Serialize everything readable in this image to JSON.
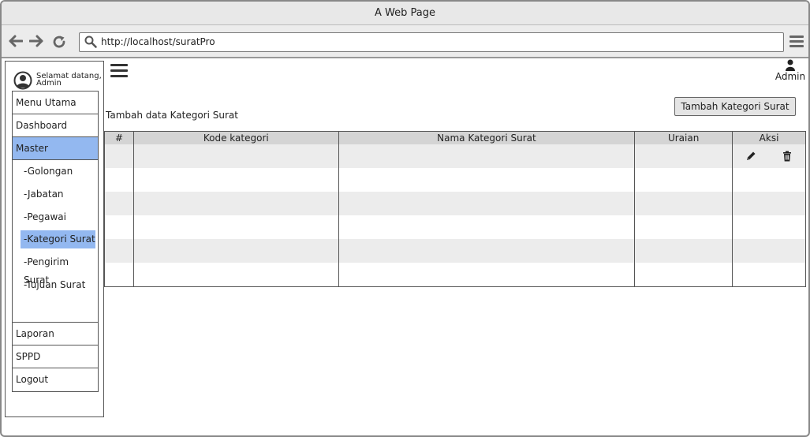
{
  "window": {
    "title": "A Web Page"
  },
  "browser": {
    "url": "http://localhost/suratPro",
    "icons": [
      "back-arrow-icon",
      "forward-arrow-icon",
      "reload-icon",
      "search-icon",
      "menu-icon"
    ]
  },
  "sidebar": {
    "welcome_line1": "Selamat datang,",
    "welcome_line2": "Admin",
    "menu": [
      {
        "label": "Menu Utama"
      },
      {
        "label": "Dashboard"
      },
      {
        "label": "Master",
        "active": true
      }
    ],
    "submenu": [
      {
        "label": "-Golongan"
      },
      {
        "label": "-Jabatan"
      },
      {
        "label": "-Pegawai"
      },
      {
        "label": "-Kategori Surat",
        "active": true
      },
      {
        "label": "-Pengirim Surat"
      },
      {
        "label": "-Tujuan Surat"
      }
    ],
    "menu_bottom": [
      {
        "label": "Laporan"
      },
      {
        "label": "SPPD"
      },
      {
        "label": "Logout"
      }
    ]
  },
  "header": {
    "user_label": "Admin"
  },
  "main": {
    "heading": "Tambah data Kategori Surat",
    "add_button": "Tambah Kategori Surat",
    "table": {
      "columns": [
        "#",
        "Kode kategori",
        "Nama Kategori Surat",
        "Uraian",
        "Aksi"
      ],
      "row_count": 6,
      "actions": [
        "edit-icon",
        "delete-icon"
      ]
    }
  },
  "colors": {
    "active_menu": "#93b8f0",
    "table_header": "#d4d4d4",
    "row_stripe": "#ececec"
  }
}
